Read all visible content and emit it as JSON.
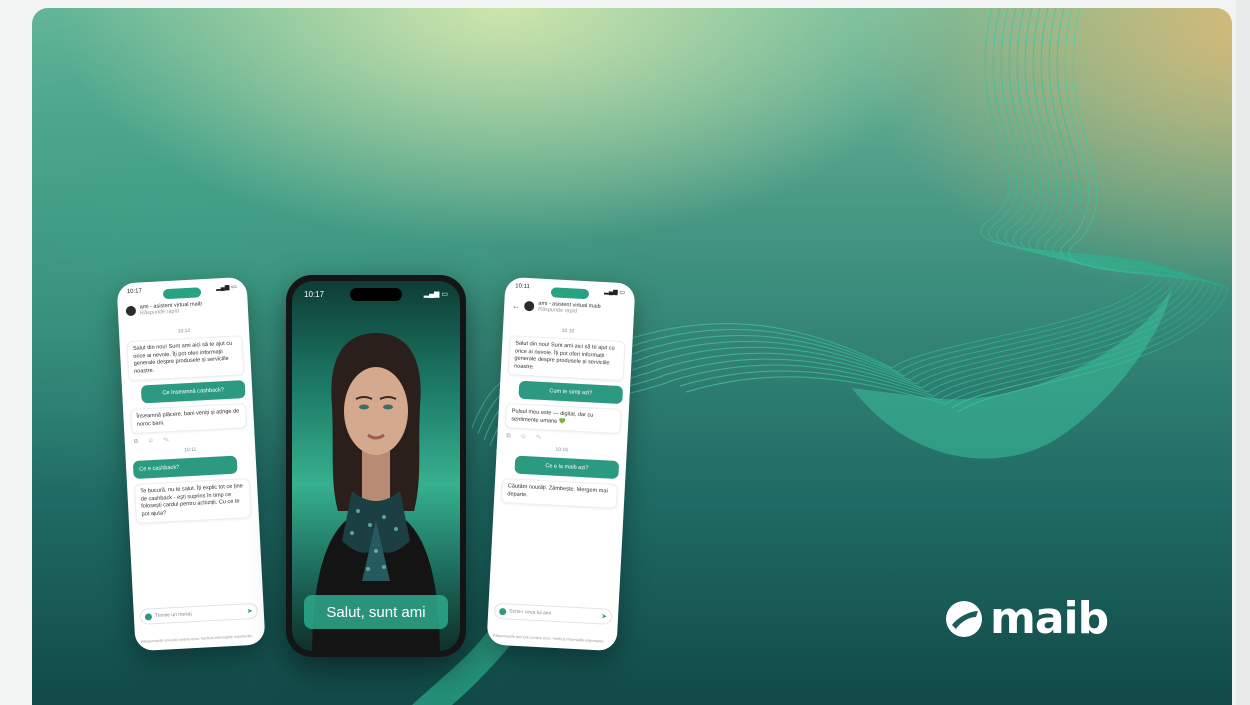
{
  "left_phone": {
    "status_time": "10:17",
    "chat_title": "ami - asistent virtual maib",
    "chat_subtitle": "Răspunde rapid",
    "time1": "10:12",
    "bot_msg1": "Salut din nou! Sunt ami aici să te ajut cu orice ai nevoie. Îți pot oferi informații generale despre produsele și serviciile noastre.",
    "user_msg1": "Ce înseamnă cashback?",
    "bot_msg2": "Înseamnă plăcere, bani veniți și atinge de noroc bani.",
    "time2": "10:11",
    "user_msg2": "Ce e cashback?",
    "bot_msg3": "Te bucură, nu te salut. Îți explic tot ce ține de cashback - ești suprins în timp ce folosești cardul pentru achiziții. Cu ce te pot ajuta?",
    "input_placeholder": "Trimite un mesaj",
    "disclaimer": "Răspunsurile ami pot conține erori. Verifică informațiile importante."
  },
  "center_phone": {
    "status_time": "10:17",
    "caption": "Salut, sunt ami"
  },
  "right_phone": {
    "status_time": "10:11",
    "chat_title": "ami - asistent virtual maib",
    "chat_subtitle": "Răspunde rapid",
    "time1": "10:10",
    "bot_msg1": "Salut din nou! Sunt ami aici să te ajut cu orice ai nevoie. Îți pot oferi informații generale despre produsele și serviciile noastre.",
    "user_msg1": "Cum te simți azi?",
    "bot_msg2": "Pulsul meu este — digital, dar cu sentimente umane 💚",
    "time2": "10:15",
    "user_msg2": "Ce e la maib azi?",
    "bot_msg3": "Căutăm noutăți. Zâmbește. Mergem mai departe.",
    "input_placeholder": "Scrie-i ceva lui ami",
    "disclaimer": "Răspunsurile ami pot conține erori. Verifică informațiile importante."
  },
  "brand": {
    "logo_text": "maib",
    "accent": "#2b9a80"
  }
}
